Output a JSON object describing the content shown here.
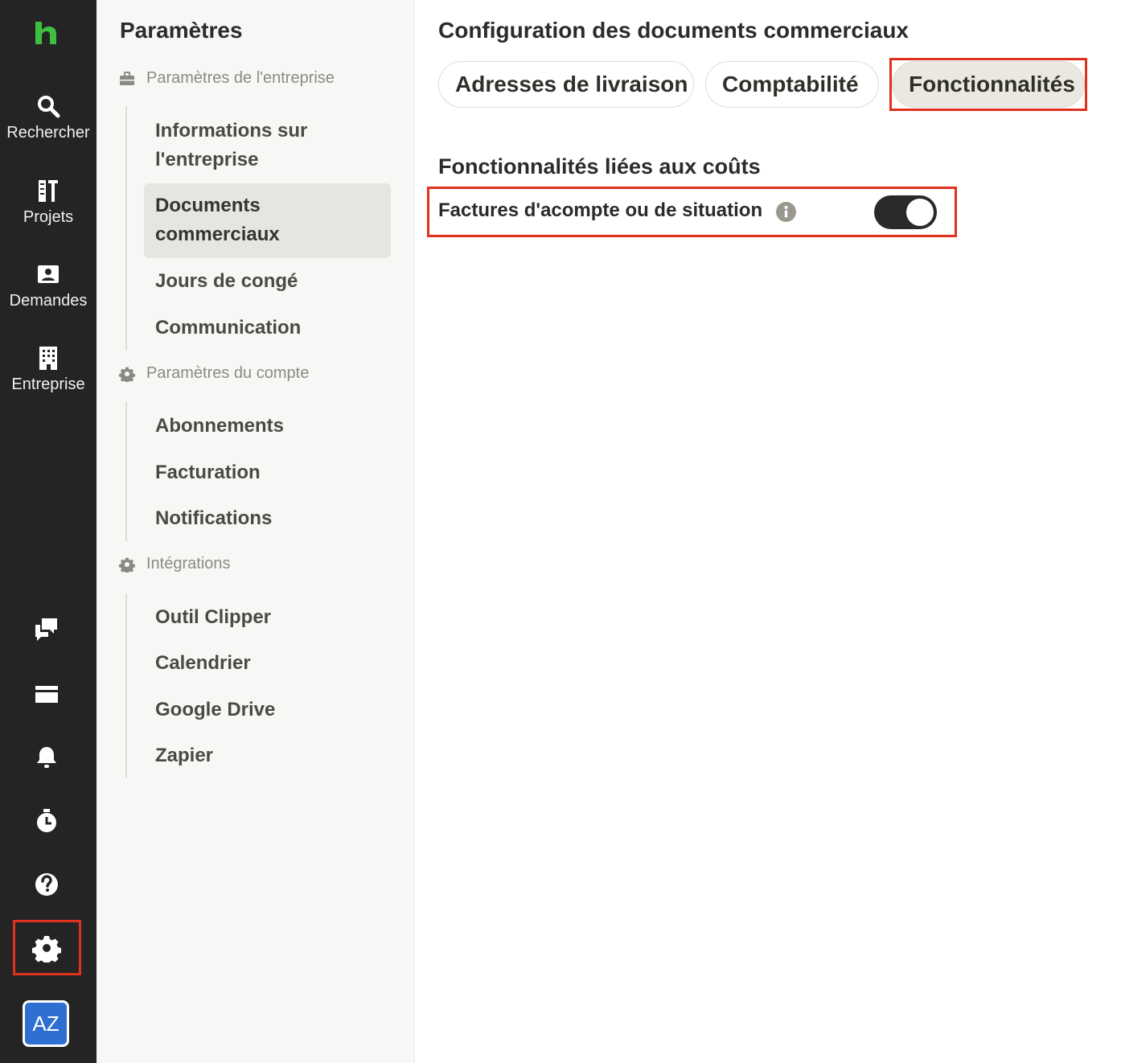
{
  "rail": {
    "items": [
      {
        "label": "Rechercher"
      },
      {
        "label": "Projets"
      },
      {
        "label": "Demandes"
      },
      {
        "label": "Entreprise"
      }
    ],
    "avatar_initials": "AZ"
  },
  "sidebar": {
    "title": "Paramètres",
    "groups": [
      {
        "label": "Paramètres de l'entreprise",
        "items": [
          "Informations sur l'entreprise",
          "Documents commerciaux",
          "Jours de congé",
          "Communication"
        ]
      },
      {
        "label": "Paramètres du compte",
        "items": [
          "Abonnements",
          "Facturation",
          "Notifications"
        ]
      },
      {
        "label": "Intégrations",
        "items": [
          "Outil Clipper",
          "Calendrier",
          "Google Drive",
          "Zapier"
        ]
      }
    ],
    "active_item": "Documents commerciaux"
  },
  "main": {
    "title": "Configuration des documents commerciaux",
    "tabs": [
      {
        "label": "Adresses de livraison"
      },
      {
        "label": "Comptabilité"
      },
      {
        "label": "Fonctionnalités"
      }
    ],
    "active_tab": "Fonctionnalités",
    "section_title": "Fonctionnalités liées aux coûts",
    "setting": {
      "label": "Factures d'acompte ou de situation",
      "enabled": true
    }
  },
  "colors": {
    "brand_green": "#3fbf3f",
    "highlight_red": "#e0301e",
    "rail_bg": "#242424",
    "avatar_blue": "#2f6fd1"
  }
}
